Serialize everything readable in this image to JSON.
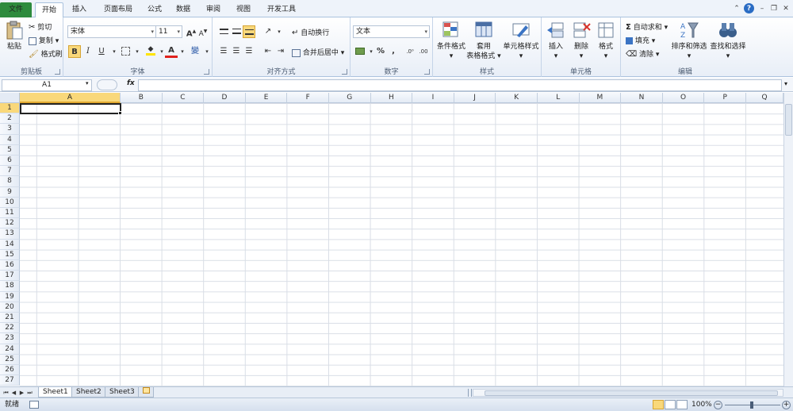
{
  "tabs": {
    "file": "文件",
    "home": "开始",
    "insert": "插入",
    "page_layout": "页面布局",
    "formulas": "公式",
    "data": "数据",
    "review": "审阅",
    "view": "视图",
    "developer": "开发工具"
  },
  "clipboard": {
    "paste": "粘贴",
    "cut": "剪切",
    "copy": "复制",
    "format_painter": "格式刷",
    "label": "剪贴板"
  },
  "font": {
    "name": "宋体",
    "size": "11",
    "bold": "B",
    "italic": "I",
    "underline": "U",
    "wen": "變",
    "label": "字体"
  },
  "alignment": {
    "wrap_text": "自动换行",
    "merge_center": "合并后居中",
    "label": "对齐方式"
  },
  "number": {
    "format": "文本",
    "percent": "%",
    "comma": ",",
    "label": "数字"
  },
  "styles": {
    "conditional_format": "条件格式",
    "format_as_table_1": "套用",
    "format_as_table_2": "表格格式",
    "cell_styles": "单元格样式",
    "label": "样式"
  },
  "cells_group": {
    "insert": "插入",
    "delete": "删除",
    "format": "格式",
    "label": "单元格"
  },
  "editing": {
    "autosum": "自动求和",
    "fill": "填充",
    "clear": "清除",
    "sort_filter": "排序和筛选",
    "find_select": "查找和选择",
    "label": "编辑"
  },
  "formula_bar": {
    "name_box": "A1",
    "fx": "fx",
    "value": ""
  },
  "grid": {
    "columns": [
      "A",
      "B",
      "C",
      "D",
      "E",
      "F",
      "G",
      "H",
      "I",
      "J",
      "K",
      "L",
      "M",
      "N",
      "O",
      "P",
      "Q"
    ],
    "rows": [
      "1",
      "2",
      "3",
      "4",
      "5",
      "6",
      "7",
      "8",
      "9",
      "10",
      "11",
      "12",
      "13",
      "14",
      "15",
      "16",
      "17",
      "18",
      "19",
      "20",
      "21",
      "22",
      "23",
      "24",
      "25",
      "26",
      "27"
    ],
    "active_cell": "A1"
  },
  "sheets": {
    "tabs": [
      "Sheet1",
      "Sheet2",
      "Sheet3"
    ],
    "active": "Sheet1"
  },
  "status": {
    "ready": "就绪",
    "zoom": "100%"
  },
  "colors": {
    "file_tab": "#2e8b3d",
    "active_header": "#f9d87a",
    "ribbon_border": "#aac2de"
  }
}
